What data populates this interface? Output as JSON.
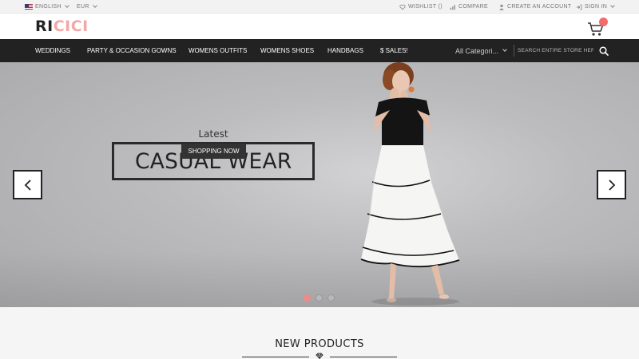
{
  "topbar": {
    "language": "ENGLISH",
    "currency": "EUR",
    "wishlist": "WISHLIST ()",
    "compare": "COMPARE",
    "create_account": "CREATE AN ACCOUNT",
    "sign_in": "SIGN IN"
  },
  "header": {
    "logo_part1": "RI",
    "logo_part2": "CICI",
    "cart_icon": "shopping-cart-icon"
  },
  "nav": {
    "items": [
      {
        "label": "WEDDINGS"
      },
      {
        "label": "PARTY & OCCASION GOWNS"
      },
      {
        "label": "WOMENS OUTFITS"
      },
      {
        "label": "WOMENS SHOES"
      },
      {
        "label": "HANDBAGS"
      },
      {
        "label": "$ SALES!"
      }
    ],
    "category_select": "All Categori...",
    "search_placeholder": "SEARCH ENTIRE STORE HERE..."
  },
  "hero": {
    "latest": "Latest",
    "title": "CASUAL WEAR",
    "button": "SHOPPING NOW",
    "slides_total": 3,
    "active_slide": 1
  },
  "new_products": {
    "title": "NEW PRODUCTS"
  },
  "colors": {
    "accent": "#f4a7a7",
    "nav_bg": "#222222",
    "badge": "#f36c6c"
  }
}
